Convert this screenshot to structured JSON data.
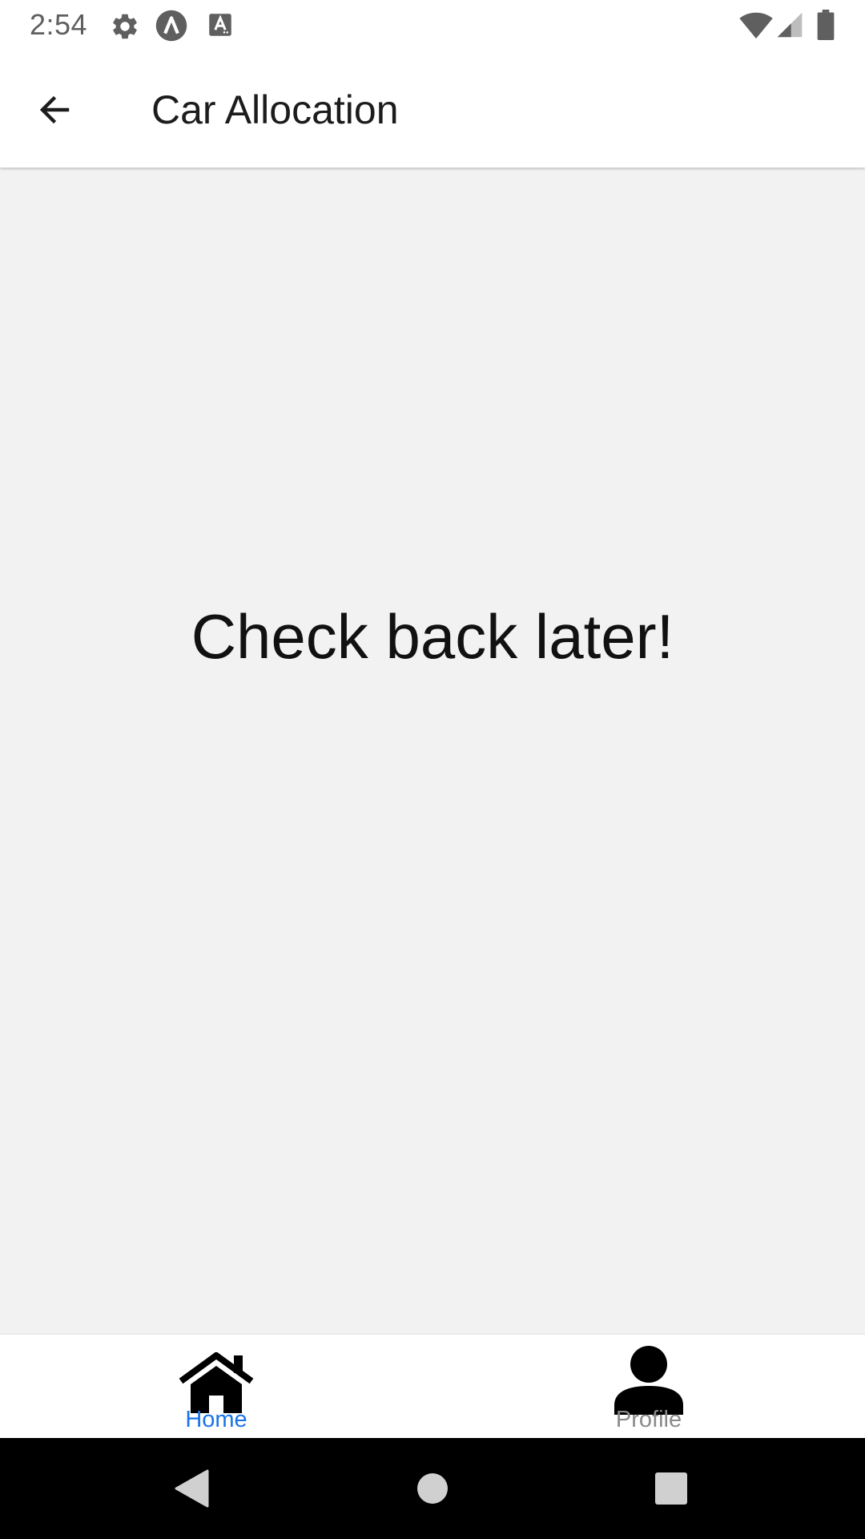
{
  "status_bar": {
    "time": "2:54",
    "icons": [
      "gear-icon",
      "circle-lambda-icon",
      "text-a-icon",
      "wifi-icon",
      "cell-signal-icon",
      "battery-icon"
    ]
  },
  "header": {
    "title": "Car Allocation",
    "back_icon": "arrow-left-icon"
  },
  "main": {
    "message": "Check back later!"
  },
  "tab_bar": {
    "tabs": [
      {
        "label": "Home",
        "icon": "home-icon",
        "selected": true,
        "color": "#1a73e8"
      },
      {
        "label": "Profile",
        "icon": "person-icon",
        "selected": false,
        "color": "#8a8a8a"
      }
    ]
  },
  "system_nav": {
    "buttons": [
      "back-triangle-icon",
      "home-circle-icon",
      "recents-square-icon"
    ]
  },
  "colors": {
    "background": "#f2f2f2",
    "accent": "#1a73e8",
    "inactive": "#8a8a8a"
  }
}
